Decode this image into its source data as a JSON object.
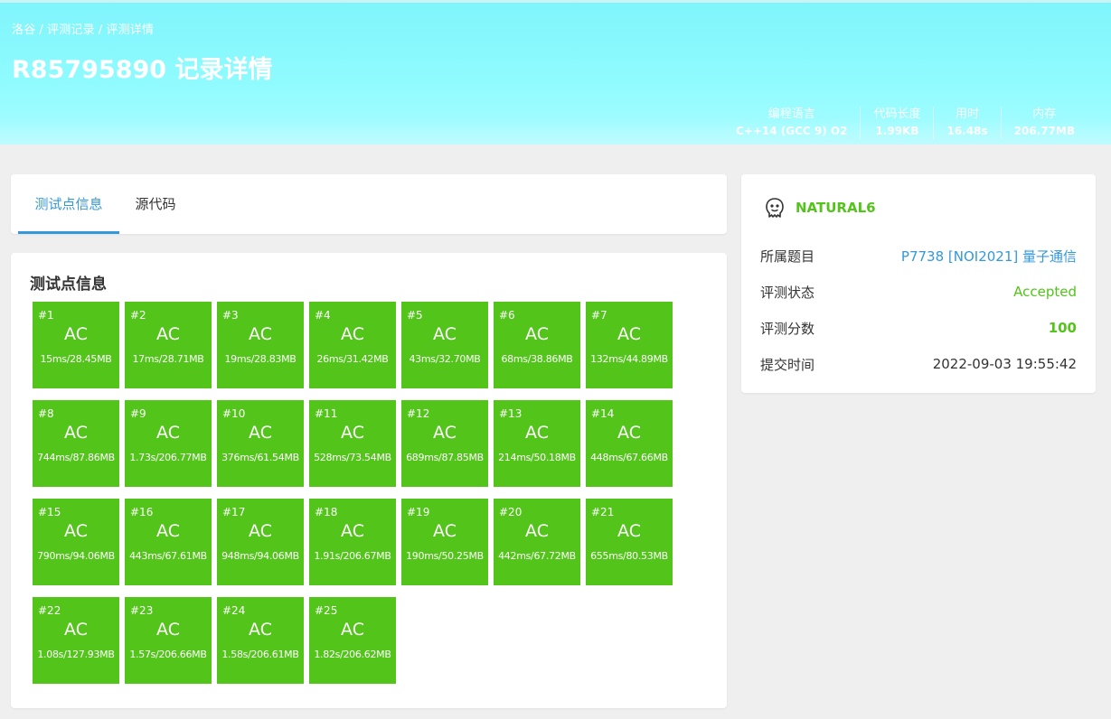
{
  "breadcrumb": {
    "items": [
      "洛谷",
      "评测记录",
      "评测详情"
    ],
    "separator": "/"
  },
  "title": "R85795890 记录详情",
  "stats": [
    {
      "label": "编程语言",
      "value": "C++14 (GCC 9) O2"
    },
    {
      "label": "代码长度",
      "value": "1.99KB"
    },
    {
      "label": "用时",
      "value": "16.48s"
    },
    {
      "label": "内存",
      "value": "206.77MB"
    }
  ],
  "tabs": [
    {
      "label": "测试点信息",
      "active": true
    },
    {
      "label": "源代码",
      "active": false
    }
  ],
  "section_title": "测试点信息",
  "colors": {
    "ac": "#52c41a",
    "accent": "#3498db",
    "banner": "#8ffbff"
  },
  "testcases": [
    {
      "id": "#1",
      "status": "AC",
      "info": "15ms/28.45MB"
    },
    {
      "id": "#2",
      "status": "AC",
      "info": "17ms/28.71MB"
    },
    {
      "id": "#3",
      "status": "AC",
      "info": "19ms/28.83MB"
    },
    {
      "id": "#4",
      "status": "AC",
      "info": "26ms/31.42MB"
    },
    {
      "id": "#5",
      "status": "AC",
      "info": "43ms/32.70MB"
    },
    {
      "id": "#6",
      "status": "AC",
      "info": "68ms/38.86MB"
    },
    {
      "id": "#7",
      "status": "AC",
      "info": "132ms/44.89MB"
    },
    {
      "id": "#8",
      "status": "AC",
      "info": "744ms/87.86MB"
    },
    {
      "id": "#9",
      "status": "AC",
      "info": "1.73s/206.77MB"
    },
    {
      "id": "#10",
      "status": "AC",
      "info": "376ms/61.54MB"
    },
    {
      "id": "#11",
      "status": "AC",
      "info": "528ms/73.54MB"
    },
    {
      "id": "#12",
      "status": "AC",
      "info": "689ms/87.85MB"
    },
    {
      "id": "#13",
      "status": "AC",
      "info": "214ms/50.18MB"
    },
    {
      "id": "#14",
      "status": "AC",
      "info": "448ms/67.66MB"
    },
    {
      "id": "#15",
      "status": "AC",
      "info": "790ms/94.06MB"
    },
    {
      "id": "#16",
      "status": "AC",
      "info": "443ms/67.61MB"
    },
    {
      "id": "#17",
      "status": "AC",
      "info": "948ms/94.06MB"
    },
    {
      "id": "#18",
      "status": "AC",
      "info": "1.91s/206.67MB"
    },
    {
      "id": "#19",
      "status": "AC",
      "info": "190ms/50.25MB"
    },
    {
      "id": "#20",
      "status": "AC",
      "info": "442ms/67.72MB"
    },
    {
      "id": "#21",
      "status": "AC",
      "info": "655ms/80.53MB"
    },
    {
      "id": "#22",
      "status": "AC",
      "info": "1.08s/127.93MB"
    },
    {
      "id": "#23",
      "status": "AC",
      "info": "1.57s/206.66MB"
    },
    {
      "id": "#24",
      "status": "AC",
      "info": "1.58s/206.61MB"
    },
    {
      "id": "#25",
      "status": "AC",
      "info": "1.82s/206.62MB"
    }
  ],
  "info": {
    "user": {
      "name": "NATURAL6",
      "icon": "user-avatar-icon"
    },
    "rows": [
      {
        "label": "所属题目",
        "value": "P7738 [NOI2021] 量子通信"
      },
      {
        "label": "评测状态",
        "value": "Accepted"
      },
      {
        "label": "评测分数",
        "value": "100"
      },
      {
        "label": "提交时间",
        "value": "2022-09-03 19:55:42"
      }
    ]
  }
}
